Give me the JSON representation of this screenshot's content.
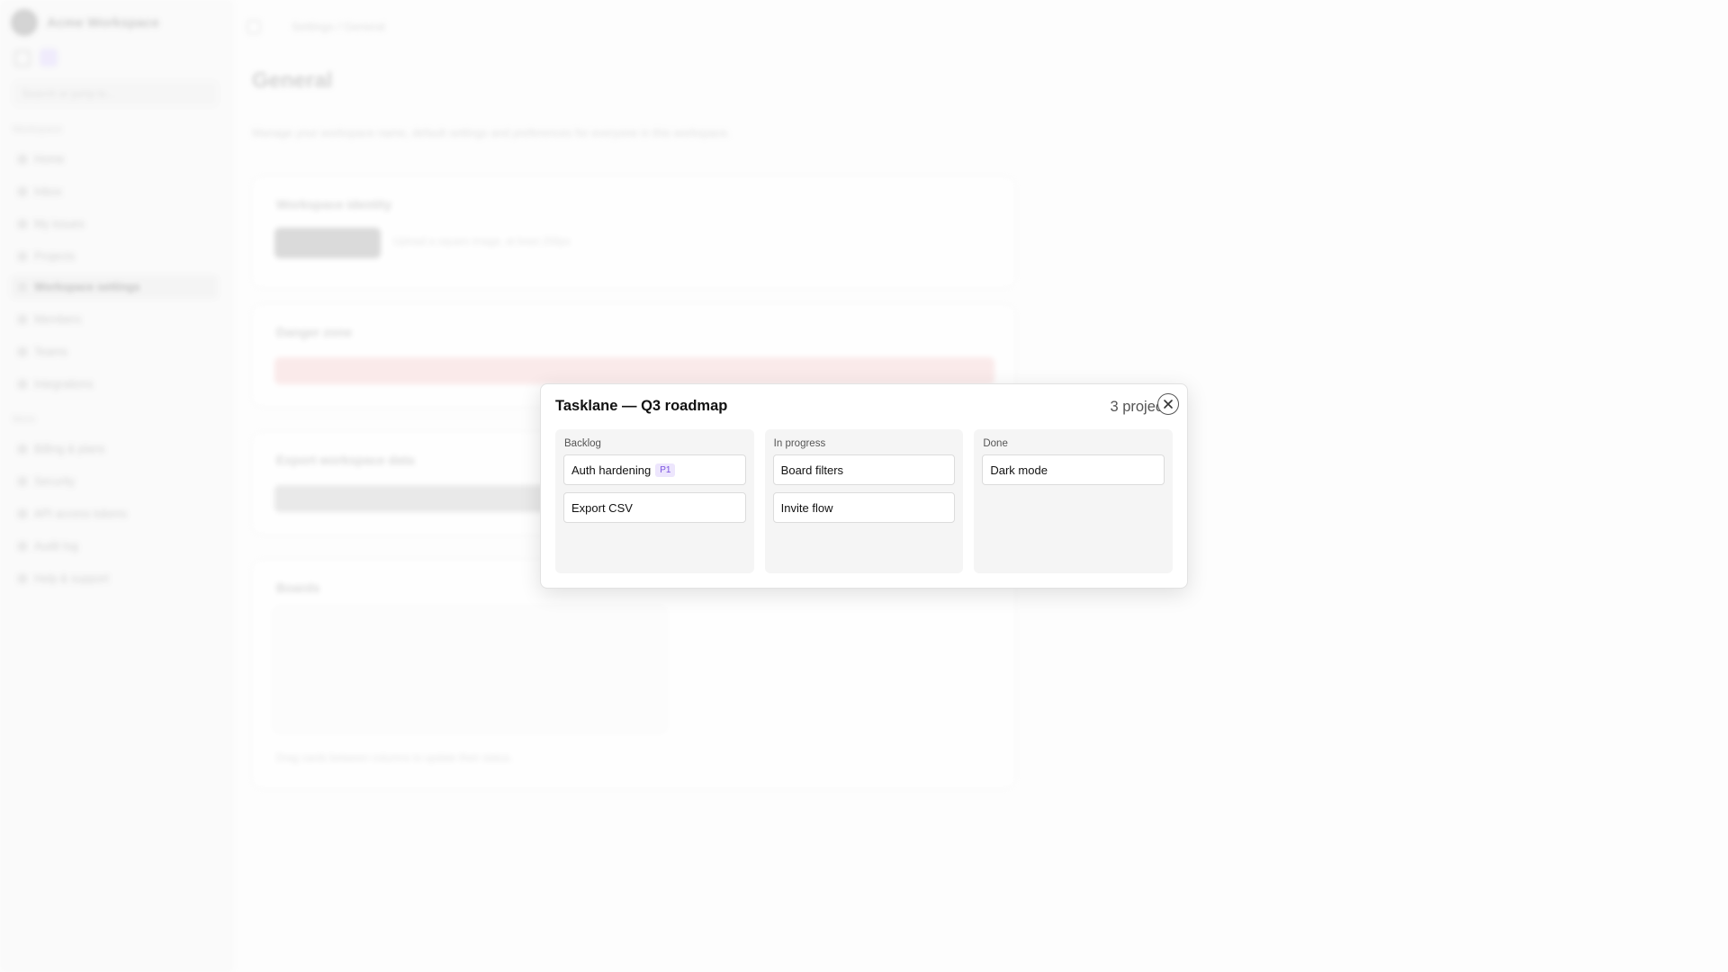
{
  "background": {
    "sidebar": {
      "brand": "Acme Workspace",
      "search_placeholder": "Search or jump to…",
      "section_main": "Workspace",
      "section_more": "More",
      "items": [
        {
          "label": "Home"
        },
        {
          "label": "Inbox"
        },
        {
          "label": "My issues"
        },
        {
          "label": "Projects"
        },
        {
          "label": "Workspace settings"
        },
        {
          "label": "Members"
        },
        {
          "label": "Teams"
        },
        {
          "label": "Integrations"
        },
        {
          "label": "Billing & plans"
        },
        {
          "label": "Security"
        },
        {
          "label": "API access tokens"
        },
        {
          "label": "Audit log"
        },
        {
          "label": "Help & support"
        }
      ]
    },
    "breadcrumb": "Settings / General",
    "page_title": "General",
    "page_description": "Manage your workspace name, default settings and preferences for everyone in this workspace.",
    "cards": [
      {
        "title": "Workspace identity",
        "hint": "Upload a square image, at least 256px"
      },
      {
        "title": "Danger zone"
      },
      {
        "title": "Export workspace data"
      },
      {
        "title": "Boards",
        "footer": "Drag cards between columns to update their status."
      }
    ]
  },
  "dialog": {
    "title": "Tasklane — Q3 roadmap",
    "count": "3 projects",
    "close_icon": "close-icon",
    "columns": [
      {
        "name": "Backlog",
        "cards": [
          {
            "title": "Auth hardening",
            "badge": "P1"
          },
          {
            "title": "Export CSV"
          }
        ]
      },
      {
        "name": "In progress",
        "cards": [
          {
            "title": "Board filters"
          },
          {
            "title": "Invite flow"
          }
        ]
      },
      {
        "name": "Done",
        "cards": [
          {
            "title": "Dark mode"
          }
        ]
      }
    ],
    "colors": {
      "badge_bg": "#ede6fd",
      "badge_text": "#7a52e0"
    }
  }
}
